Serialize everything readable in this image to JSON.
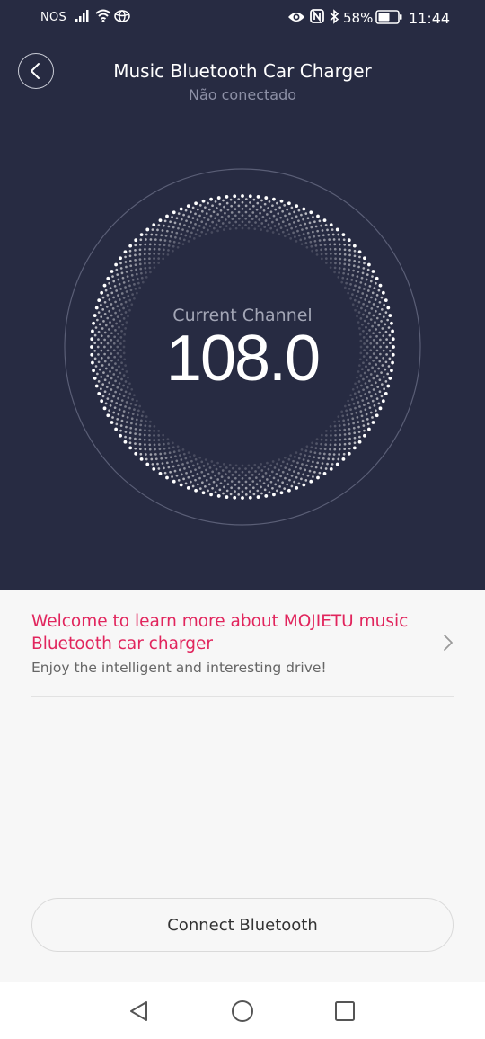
{
  "status_bar": {
    "carrier": "NOS",
    "battery": "58%",
    "time": "11:44",
    "icons": [
      "signal-icon",
      "wifi-icon",
      "car-app-icon",
      "eye-icon",
      "nfc-icon",
      "bluetooth-icon",
      "battery-icon"
    ]
  },
  "header": {
    "title": "Music Bluetooth Car Charger",
    "subtitle": "Não conectado"
  },
  "dial": {
    "label": "Current Channel",
    "value": "108.0"
  },
  "info_card": {
    "title": "Welcome to learn more about MOJIETU music Bluetooth car charger",
    "subtitle": "Enjoy the intelligent and interesting drive!"
  },
  "actions": {
    "connect_label": "Connect Bluetooth"
  },
  "colors": {
    "header_bg": "#272b42",
    "accent": "#e1255d",
    "page_bg": "#f7f7f7"
  }
}
